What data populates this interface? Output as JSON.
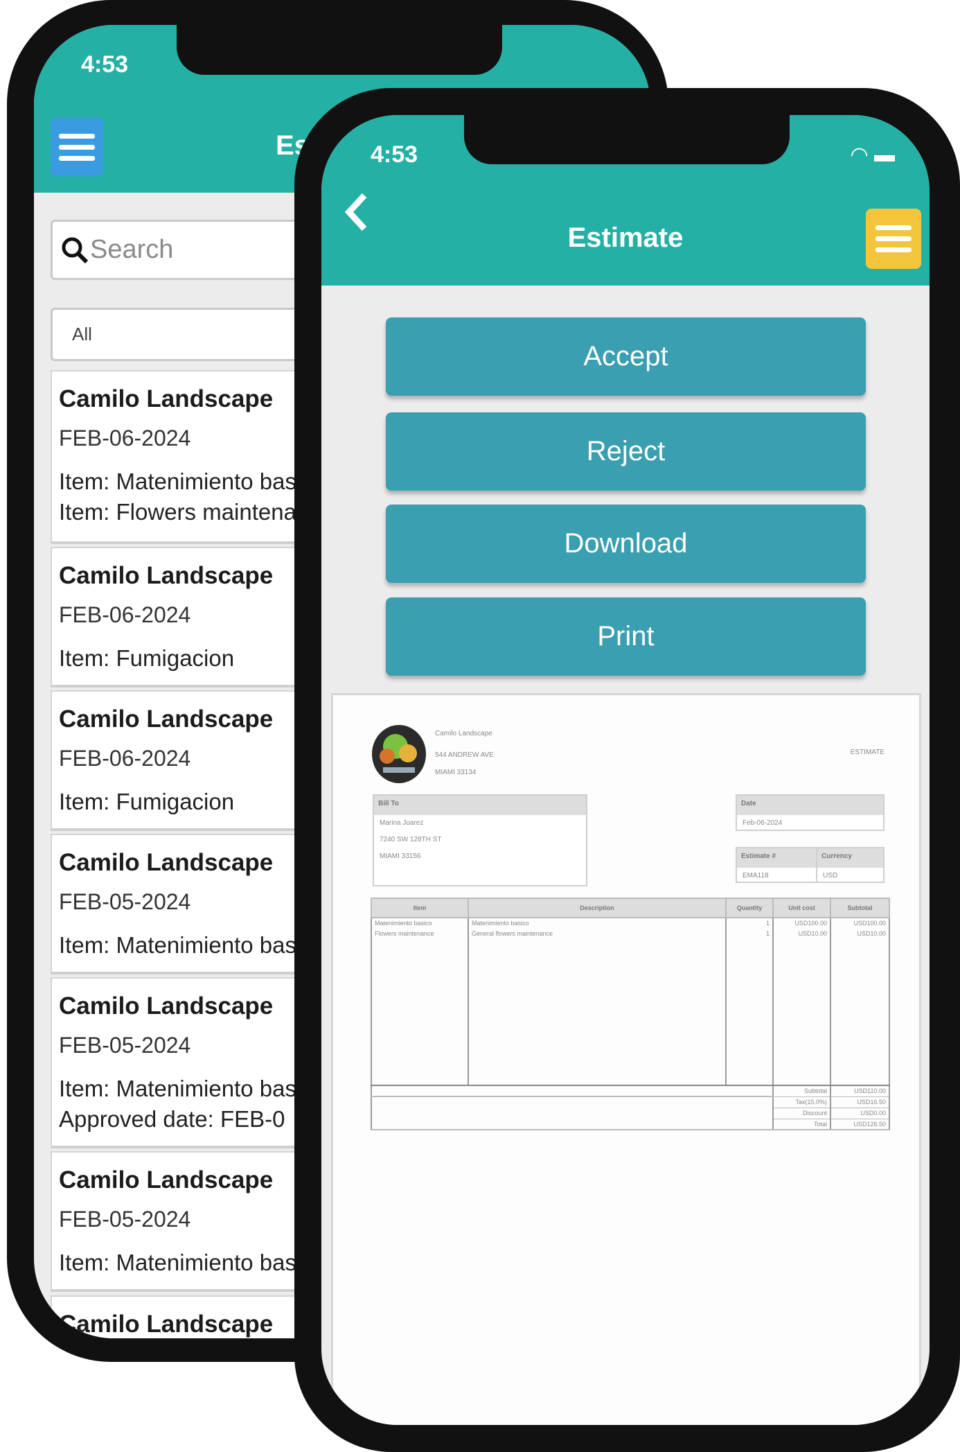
{
  "back_phone": {
    "status_time": "4:53",
    "header_title": "Estimate",
    "search_placeholder": "Search",
    "filter_value": "All",
    "cards": [
      {
        "title": "Camilo Landscape",
        "date": "FEB-06-2024",
        "lines": [
          "Item: Matenimiento basico",
          "Item: Flowers maintenance"
        ],
        "badge_color": "#c8efc8"
      },
      {
        "title": "Camilo Landscape",
        "date": "FEB-06-2024",
        "lines": [
          "Item: Fumigacion"
        ],
        "badge_color": "#c8efc8"
      },
      {
        "title": "Camilo Landscape",
        "date": "FEB-06-2024",
        "lines": [
          "Item: Fumigacion"
        ],
        "badge_color": "#c8efc8"
      },
      {
        "title": "Camilo Landscape",
        "date": "FEB-05-2024",
        "lines": [
          "Item: Matenimiento basico"
        ],
        "badge_color": "#fde0c4"
      },
      {
        "title": "Camilo Landscape",
        "date": "FEB-05-2024",
        "lines": [
          "Item: Matenimiento basico",
          "Approved date: FEB-0"
        ],
        "badge_color": "#cfe3fb"
      },
      {
        "title": "Camilo Landscape",
        "date": "FEB-05-2024",
        "lines": [
          "Item: Matenimiento basico"
        ],
        "badge_color": "#c8efc8"
      },
      {
        "title": "Camilo Landscape",
        "date": "",
        "lines": [],
        "badge_color": ""
      }
    ]
  },
  "front_phone": {
    "status_time": "4:53",
    "header_title": "Estimate",
    "buttons": {
      "accept": "Accept",
      "reject": "Reject",
      "download": "Download",
      "print": "Print"
    },
    "colors": {
      "header": "#25b0a6",
      "button": "#3a9fb0",
      "menu_back": "#3b9be0",
      "menu_front": "#f2c53d"
    },
    "document": {
      "company": {
        "name": "Camilo Landscape",
        "address": "544 ANDREW AVE",
        "city": "MIAMI 33134"
      },
      "doc_type": "ESTIMATE",
      "bill_to": {
        "label": "Bill To",
        "name": "Marina Juarez",
        "address": "7240 SW 128TH ST",
        "city": "MIAMI 33156"
      },
      "date": {
        "label": "Date",
        "value": "Feb-06-2024"
      },
      "estimate_no": {
        "label": "Estimate #",
        "value": "EMA118"
      },
      "currency": {
        "label": "Currency",
        "value": "USD"
      },
      "columns": [
        "Item",
        "Description",
        "Quantity",
        "Unit cost",
        "Subtotal"
      ],
      "rows": [
        [
          "Matenimiento basico",
          "Matenimiento basico",
          "1",
          "USD100.00",
          "USD100.00"
        ],
        [
          "Flowers maintenance",
          "General flowers maintenance",
          "1",
          "USD10.00",
          "USD10.00"
        ]
      ],
      "totals": [
        {
          "label": "Subtotal",
          "value": "USD110.00"
        },
        {
          "label": "Tax(15.0%)",
          "value": "USD16.50"
        },
        {
          "label": "Discount",
          "value": "USD0.00"
        },
        {
          "label": "Total",
          "value": "USD126.50"
        }
      ]
    }
  }
}
